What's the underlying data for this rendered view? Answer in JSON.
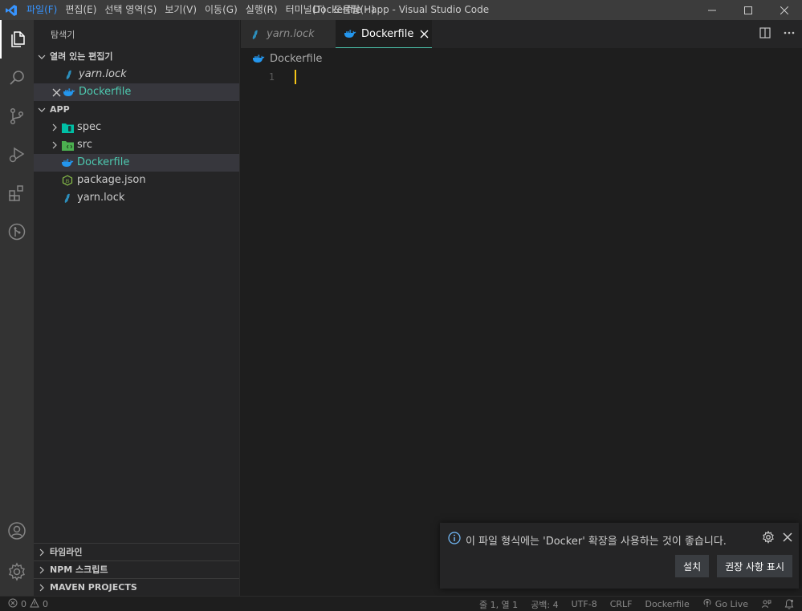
{
  "window": {
    "title": "Dockerfile - app - Visual Studio Code"
  },
  "menu": [
    {
      "label": "파일(F)"
    },
    {
      "label": "편집(E)"
    },
    {
      "label": "선택 영역(S)"
    },
    {
      "label": "보기(V)"
    },
    {
      "label": "이동(G)"
    },
    {
      "label": "실행(R)"
    },
    {
      "label": "터미널(T)"
    },
    {
      "label": "도움말(H)"
    }
  ],
  "sidebar": {
    "title": "탐색기",
    "open_editors": {
      "header": "열려 있는 편집기",
      "items": [
        {
          "label": "yarn.lock",
          "icon": "yarn-icon"
        },
        {
          "label": "Dockerfile",
          "icon": "docker-icon"
        }
      ]
    },
    "project": {
      "header": "APP",
      "items": [
        {
          "label": "spec",
          "icon": "folder-test-icon"
        },
        {
          "label": "src",
          "icon": "folder-src-icon"
        },
        {
          "label": "Dockerfile",
          "icon": "docker-icon"
        },
        {
          "label": "package.json",
          "icon": "nodejs-icon"
        },
        {
          "label": "yarn.lock",
          "icon": "yarn-icon"
        }
      ]
    },
    "bottom_sections": [
      {
        "label": "타임라인"
      },
      {
        "label": "NPM 스크립트"
      },
      {
        "label": "MAVEN PROJECTS"
      }
    ]
  },
  "editor": {
    "tabs": [
      {
        "label": "yarn.lock"
      },
      {
        "label": "Dockerfile"
      }
    ],
    "breadcrumb": "Dockerfile",
    "line_number": "1"
  },
  "notification": {
    "message": "이 파일 형식에는 'Docker' 확장을 사용하는 것이 좋습니다.",
    "install_button": "설치",
    "recommend_button": "권장 사항 표시"
  },
  "statusbar": {
    "errors": "0",
    "warnings": "0",
    "position": "줄 1, 열 1",
    "spaces": "공백: 4",
    "encoding": "UTF-8",
    "eol": "CRLF",
    "language": "Dockerfile",
    "golive": "Go Live"
  },
  "colors": {
    "accent": "#4ec9b0",
    "docker_blue": "#2496ed",
    "cursor": "#f5c518",
    "vscode_blue": "#3794ff"
  }
}
